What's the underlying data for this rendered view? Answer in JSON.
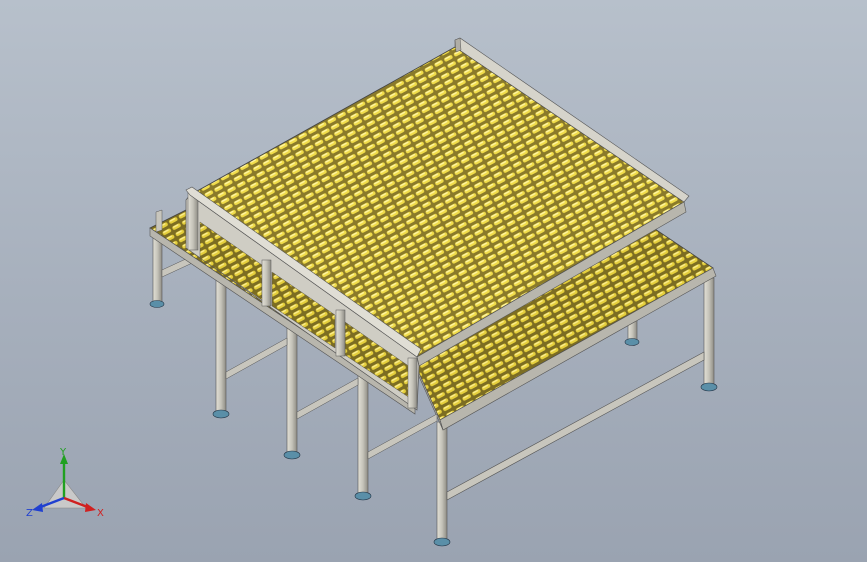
{
  "viewport": {
    "background_top": "#b7c0cb",
    "background_bottom": "#9aa3b1"
  },
  "model": {
    "description_icon": "roller-conveyor-table-model",
    "frame_color": "#c8c6bd",
    "frame_shadow": "#8f8d86",
    "deck_color": "#d9c24a",
    "roller_color": "#f2e04a",
    "foot_color": "#5a8fa8"
  },
  "triad": {
    "x_label": "X",
    "y_label": "Y",
    "z_label": "Z",
    "x_color": "#d02020",
    "y_color": "#20a020",
    "z_color": "#2040d0"
  }
}
